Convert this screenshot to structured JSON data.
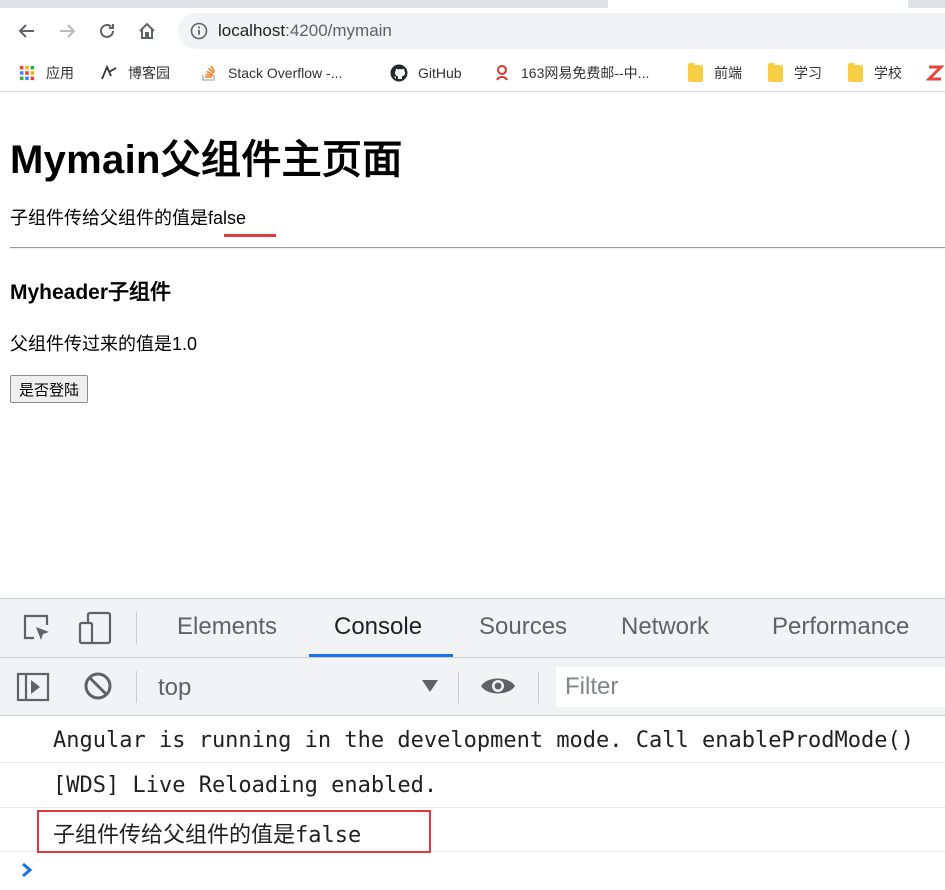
{
  "browser": {
    "url_host": "localhost",
    "url_path": ":4200/mymain",
    "bookmarks": [
      {
        "label": "应用",
        "icon": "apps-grid-icon"
      },
      {
        "label": "博客园",
        "icon": "cnblogs-icon"
      },
      {
        "label": "Stack Overflow -...",
        "icon": "stackoverflow-icon"
      },
      {
        "label": "GitHub",
        "icon": "github-icon"
      },
      {
        "label": "163网易免费邮--中...",
        "icon": "netease-icon"
      },
      {
        "label": "前端",
        "icon": "folder-icon"
      },
      {
        "label": "学习",
        "icon": "folder-icon"
      },
      {
        "label": "学校",
        "icon": "folder-icon"
      }
    ]
  },
  "page": {
    "title": "Mymain父组件主页面",
    "child_value_text": "子组件传给父组件的值是false",
    "header_title": "Myheader子组件",
    "parent_value_text": "父组件传过来的值是1.0",
    "login_button": "是否登陆"
  },
  "devtools": {
    "tabs": [
      "Elements",
      "Console",
      "Sources",
      "Network",
      "Performance"
    ],
    "active_tab": "Console",
    "context": "top",
    "filter_placeholder": "Filter",
    "messages": [
      "Angular is running in the development mode. Call enableProdMode()",
      "[WDS] Live Reloading enabled.",
      "子组件传给父组件的值是false"
    ]
  },
  "colors": {
    "accent": "#1a73e8",
    "highlight": "#e0393e",
    "folder": "#f7ce46"
  }
}
